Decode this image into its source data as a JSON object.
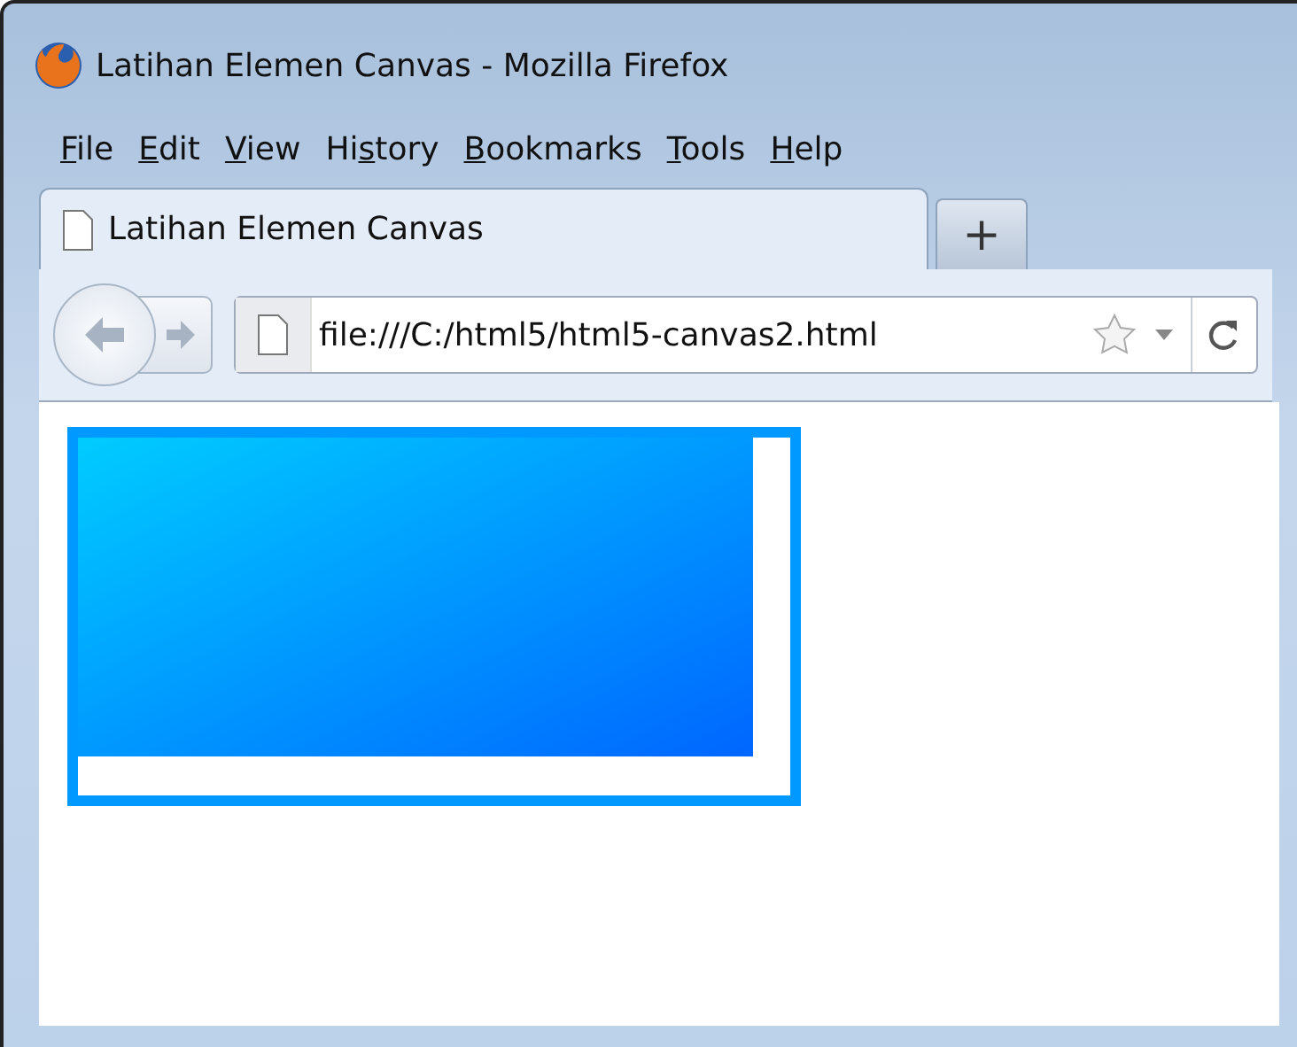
{
  "window": {
    "title": "Latihan Elemen Canvas - Mozilla Firefox"
  },
  "menu": [
    {
      "key": "F",
      "after": "ile"
    },
    {
      "key": "E",
      "after": "dit"
    },
    {
      "key": "V",
      "after": "iew"
    },
    {
      "before": "Hi",
      "key": "s",
      "after": "tory"
    },
    {
      "key": "B",
      "after": "ookmarks"
    },
    {
      "key": "T",
      "after": "ools"
    },
    {
      "key": "H",
      "after": "elp"
    }
  ],
  "tabs": [
    {
      "label": "Latihan Elemen Canvas",
      "selected": true
    }
  ],
  "new_tab": {
    "label": "+"
  },
  "address_bar": {
    "value": "file:///C:/html5/html5-canvas2.html"
  }
}
